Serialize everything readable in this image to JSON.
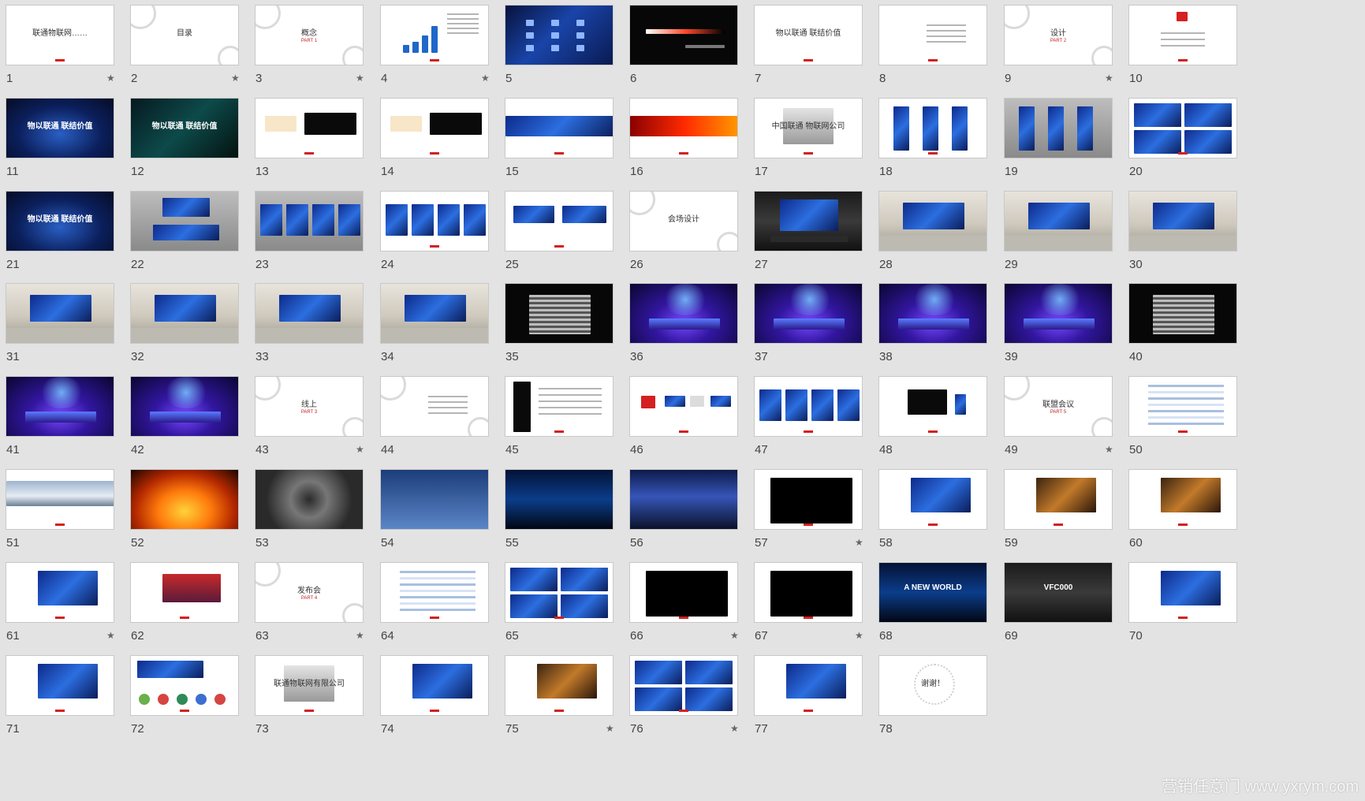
{
  "watermark": "营销任意门 www.yxrym.com",
  "star_glyph": "★",
  "slides": [
    {
      "n": "1",
      "star": true,
      "theme": "white",
      "text": "联通物联网……"
    },
    {
      "n": "2",
      "star": true,
      "theme": "white",
      "text": "目录",
      "swirl": true
    },
    {
      "n": "3",
      "star": true,
      "theme": "white",
      "text": "概念",
      "sub": "PART 1",
      "swirl": true
    },
    {
      "n": "4",
      "star": true,
      "theme": "white",
      "deco": "barchart"
    },
    {
      "n": "5",
      "star": false,
      "theme": "blue",
      "deco": "icons"
    },
    {
      "n": "6",
      "star": false,
      "theme": "black",
      "deco": "streak"
    },
    {
      "n": "7",
      "star": false,
      "theme": "white",
      "text": "物以联通 联结价值"
    },
    {
      "n": "8",
      "star": false,
      "theme": "white",
      "deco": "lines"
    },
    {
      "n": "9",
      "star": true,
      "theme": "white",
      "text": "设计",
      "sub": "PART 2",
      "swirl": true
    },
    {
      "n": "10",
      "star": false,
      "theme": "white",
      "deco": "logo"
    },
    {
      "n": "11",
      "star": false,
      "theme": "darkblue",
      "text": "物以联通 联结价值",
      "light": true
    },
    {
      "n": "12",
      "star": false,
      "theme": "teal",
      "text": "物以联通 联结价值",
      "light": true
    },
    {
      "n": "13",
      "star": false,
      "theme": "white",
      "deco": "twologos"
    },
    {
      "n": "14",
      "star": false,
      "theme": "white",
      "deco": "twologos"
    },
    {
      "n": "15",
      "star": false,
      "theme": "white",
      "deco": "band-blue"
    },
    {
      "n": "16",
      "star": false,
      "theme": "white",
      "deco": "band-red"
    },
    {
      "n": "17",
      "star": false,
      "theme": "white",
      "text": "中国联通 物联网公司",
      "deco": "plaque"
    },
    {
      "n": "18",
      "star": false,
      "theme": "white",
      "deco": "banners"
    },
    {
      "n": "19",
      "star": false,
      "theme": "gray",
      "deco": "banners"
    },
    {
      "n": "20",
      "star": false,
      "theme": "white",
      "deco": "grid4"
    },
    {
      "n": "21",
      "star": false,
      "theme": "darkblue",
      "text": "物以联通 联结价值",
      "light": true
    },
    {
      "n": "22",
      "star": false,
      "theme": "gray",
      "deco": "desk"
    },
    {
      "n": "23",
      "star": false,
      "theme": "gray",
      "deco": "posters"
    },
    {
      "n": "24",
      "star": false,
      "theme": "white",
      "deco": "posters"
    },
    {
      "n": "25",
      "star": false,
      "theme": "white",
      "deco": "signs"
    },
    {
      "n": "26",
      "star": false,
      "theme": "white",
      "text": "会场设计",
      "swirl": true
    },
    {
      "n": "27",
      "star": false,
      "theme": "hall",
      "deco": "screen"
    },
    {
      "n": "28",
      "star": false,
      "theme": "room",
      "deco": "room"
    },
    {
      "n": "29",
      "star": false,
      "theme": "room",
      "deco": "room"
    },
    {
      "n": "30",
      "star": false,
      "theme": "room",
      "deco": "room"
    },
    {
      "n": "31",
      "star": false,
      "theme": "room",
      "deco": "room"
    },
    {
      "n": "32",
      "star": false,
      "theme": "room",
      "deco": "room"
    },
    {
      "n": "33",
      "star": false,
      "theme": "room",
      "deco": "room"
    },
    {
      "n": "34",
      "star": false,
      "theme": "room",
      "deco": "room"
    },
    {
      "n": "35",
      "star": false,
      "theme": "black",
      "deco": "seats"
    },
    {
      "n": "36",
      "star": false,
      "theme": "purple",
      "deco": "stage"
    },
    {
      "n": "37",
      "star": false,
      "theme": "purple",
      "deco": "stage"
    },
    {
      "n": "38",
      "star": false,
      "theme": "purple",
      "deco": "stage"
    },
    {
      "n": "39",
      "star": false,
      "theme": "purple",
      "deco": "stage"
    },
    {
      "n": "40",
      "star": false,
      "theme": "black",
      "deco": "seats"
    },
    {
      "n": "41",
      "star": false,
      "theme": "purple",
      "deco": "stage"
    },
    {
      "n": "42",
      "star": false,
      "theme": "purple",
      "deco": "stage"
    },
    {
      "n": "43",
      "star": true,
      "theme": "white",
      "text": "线上",
      "sub": "PART 3",
      "swirl": true
    },
    {
      "n": "44",
      "star": false,
      "theme": "white",
      "deco": "lines",
      "swirl": true
    },
    {
      "n": "45",
      "star": false,
      "theme": "white",
      "deco": "phone"
    },
    {
      "n": "46",
      "star": false,
      "theme": "white",
      "deco": "flow"
    },
    {
      "n": "47",
      "star": false,
      "theme": "white",
      "deco": "posters"
    },
    {
      "n": "48",
      "star": false,
      "theme": "white",
      "deco": "devices"
    },
    {
      "n": "49",
      "star": true,
      "theme": "white",
      "text": "联盟会议",
      "sub": "PART 5",
      "swirl": true
    },
    {
      "n": "50",
      "star": false,
      "theme": "white",
      "deco": "table"
    },
    {
      "n": "51",
      "star": false,
      "theme": "white",
      "deco": "skyline"
    },
    {
      "n": "52",
      "star": false,
      "theme": "fire"
    },
    {
      "n": "53",
      "star": false,
      "theme": "chip"
    },
    {
      "n": "54",
      "star": false,
      "theme": "pc"
    },
    {
      "n": "55",
      "star": false,
      "theme": "stage"
    },
    {
      "n": "56",
      "star": false,
      "theme": "city"
    },
    {
      "n": "57",
      "star": true,
      "theme": "white",
      "deco": "video"
    },
    {
      "n": "58",
      "star": false,
      "theme": "white",
      "deco": "photo-blue"
    },
    {
      "n": "59",
      "star": false,
      "theme": "white",
      "deco": "photo-warm"
    },
    {
      "n": "60",
      "star": false,
      "theme": "white",
      "deco": "photo-warm"
    },
    {
      "n": "61",
      "star": true,
      "theme": "white",
      "deco": "photo-blue"
    },
    {
      "n": "62",
      "star": false,
      "theme": "white",
      "deco": "photo-red"
    },
    {
      "n": "63",
      "star": true,
      "theme": "white",
      "text": "发布会",
      "sub": "PART 4",
      "swirl": true
    },
    {
      "n": "64",
      "star": false,
      "theme": "white",
      "deco": "table"
    },
    {
      "n": "65",
      "star": false,
      "theme": "white",
      "deco": "grid4"
    },
    {
      "n": "66",
      "star": true,
      "theme": "white",
      "deco": "video"
    },
    {
      "n": "67",
      "star": true,
      "theme": "white",
      "deco": "video"
    },
    {
      "n": "68",
      "star": false,
      "theme": "stage",
      "text": "A NEW WORLD",
      "light": true
    },
    {
      "n": "69",
      "star": false,
      "theme": "hall",
      "text": "VFC000",
      "light": true
    },
    {
      "n": "70",
      "star": false,
      "theme": "white",
      "deco": "photo-blue"
    },
    {
      "n": "71",
      "star": false,
      "theme": "white",
      "deco": "photo-blue"
    },
    {
      "n": "72",
      "star": false,
      "theme": "white",
      "deco": "dots"
    },
    {
      "n": "73",
      "star": false,
      "theme": "white",
      "text": "联通物联网有限公司",
      "deco": "plaque"
    },
    {
      "n": "74",
      "star": false,
      "theme": "white",
      "deco": "photo-blue"
    },
    {
      "n": "75",
      "star": true,
      "theme": "white",
      "deco": "photo-warm"
    },
    {
      "n": "76",
      "star": true,
      "theme": "white",
      "deco": "grid4"
    },
    {
      "n": "77",
      "star": false,
      "theme": "white",
      "deco": "photo-blue"
    },
    {
      "n": "78",
      "star": false,
      "theme": "white",
      "text": "谢谢！",
      "deco": "ring"
    }
  ]
}
